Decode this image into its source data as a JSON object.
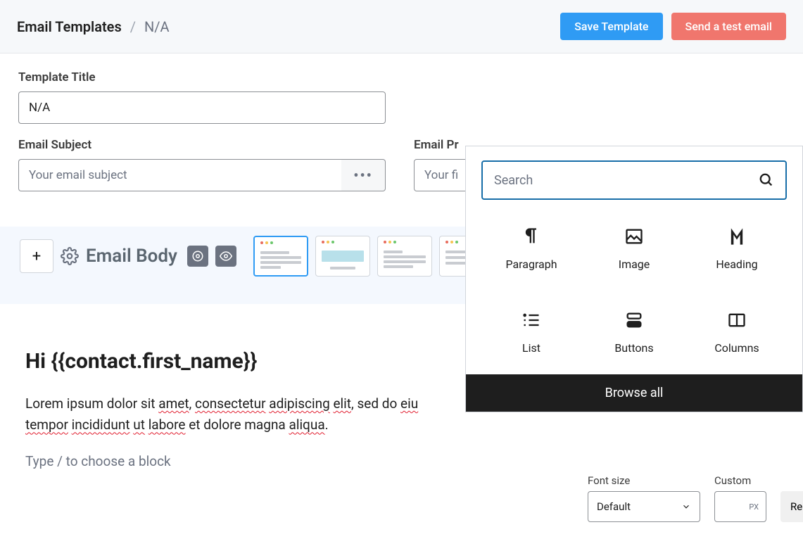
{
  "header": {
    "breadcrumb_root": "Email Templates",
    "breadcrumb_current": "N/A",
    "save_label": "Save Template",
    "test_label": "Send a test email"
  },
  "form": {
    "title_label": "Template Title",
    "title_value": "N/A",
    "subject_label": "Email Subject",
    "subject_placeholder": "Your email subject",
    "preheader_label": "Email Pr",
    "preheader_placeholder": "Your fi"
  },
  "body": {
    "title": "Email Body",
    "heading": "Hi {{contact.first_name}}",
    "paragraph_parts": {
      "p0": "Lorem ipsum dolor sit ",
      "p1": "amet",
      "p2": ", ",
      "p3": "consectetur",
      "p4": " ",
      "p5": "adipiscing",
      "p6": " ",
      "p7": "elit",
      "p8": ", sed do ",
      "p9": "eiu",
      "p10": "tempor",
      "p11": " ",
      "p12": "incididunt",
      "p13": " ",
      "p14": "ut",
      "p15": " ",
      "p16": "labore",
      "p17": " et dolore magna ",
      "p18": "aliqua",
      "p19": "."
    },
    "slash_placeholder": "Type / to choose a block"
  },
  "inserter": {
    "search_placeholder": "Search",
    "blocks": {
      "paragraph": "Paragraph",
      "image": "Image",
      "heading": "Heading",
      "list": "List",
      "buttons": "Buttons",
      "columns": "Columns"
    },
    "browse_all": "Browse all"
  },
  "sidebar": {
    "font_size_label": "Font size",
    "custom_label": "Custom",
    "select_value": "Default",
    "unit": "PX",
    "reset": "Reset"
  }
}
